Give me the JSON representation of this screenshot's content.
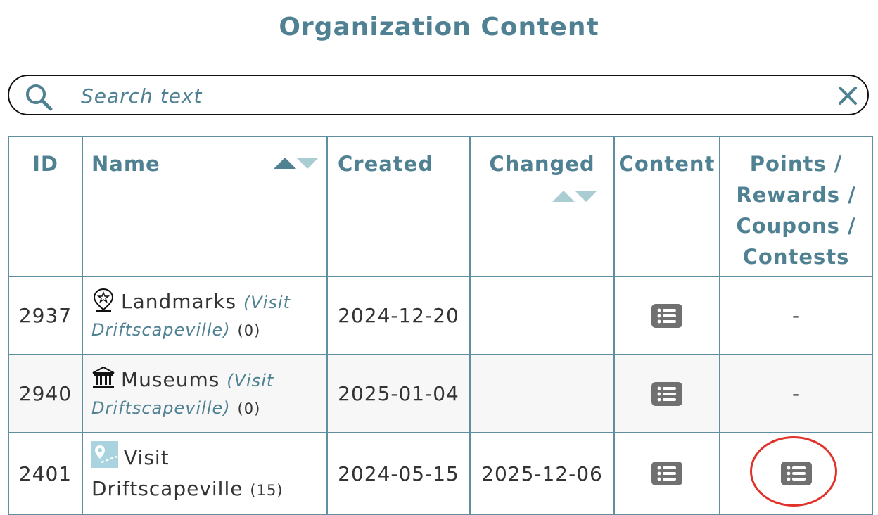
{
  "page": {
    "title": "Organization Content"
  },
  "search": {
    "placeholder": "Search text",
    "value": ""
  },
  "table": {
    "headers": {
      "id": "ID",
      "name": "Name",
      "created": "Created",
      "changed": "Changed",
      "content": "Content",
      "points": "Points / Rewards / Coupons / Contests"
    },
    "rows": [
      {
        "id": "2937",
        "name": "Landmarks",
        "org": "(Visit Driftscapeville)",
        "count": "(0)",
        "created": "2024-12-20",
        "changed": "",
        "points": "-",
        "icon": "landmark-pin-icon"
      },
      {
        "id": "2940",
        "name": "Museums",
        "org": "(Visit Driftscapeville)",
        "count": "(0)",
        "created": "2025-01-04",
        "changed": "",
        "points": "-",
        "icon": "museum-icon"
      },
      {
        "id": "2401",
        "name": "Visit Driftscapeville",
        "org": "",
        "count": "(15)",
        "created": "2024-05-15",
        "changed": "2025-12-06",
        "points": "",
        "icon": "map-route-icon"
      }
    ]
  },
  "colors": {
    "accent": "#4f8193",
    "border": "#5f8fa0",
    "icon_gray": "#707070",
    "highlight": "#e0322a",
    "sort_inactive": "#a9cdd3"
  }
}
